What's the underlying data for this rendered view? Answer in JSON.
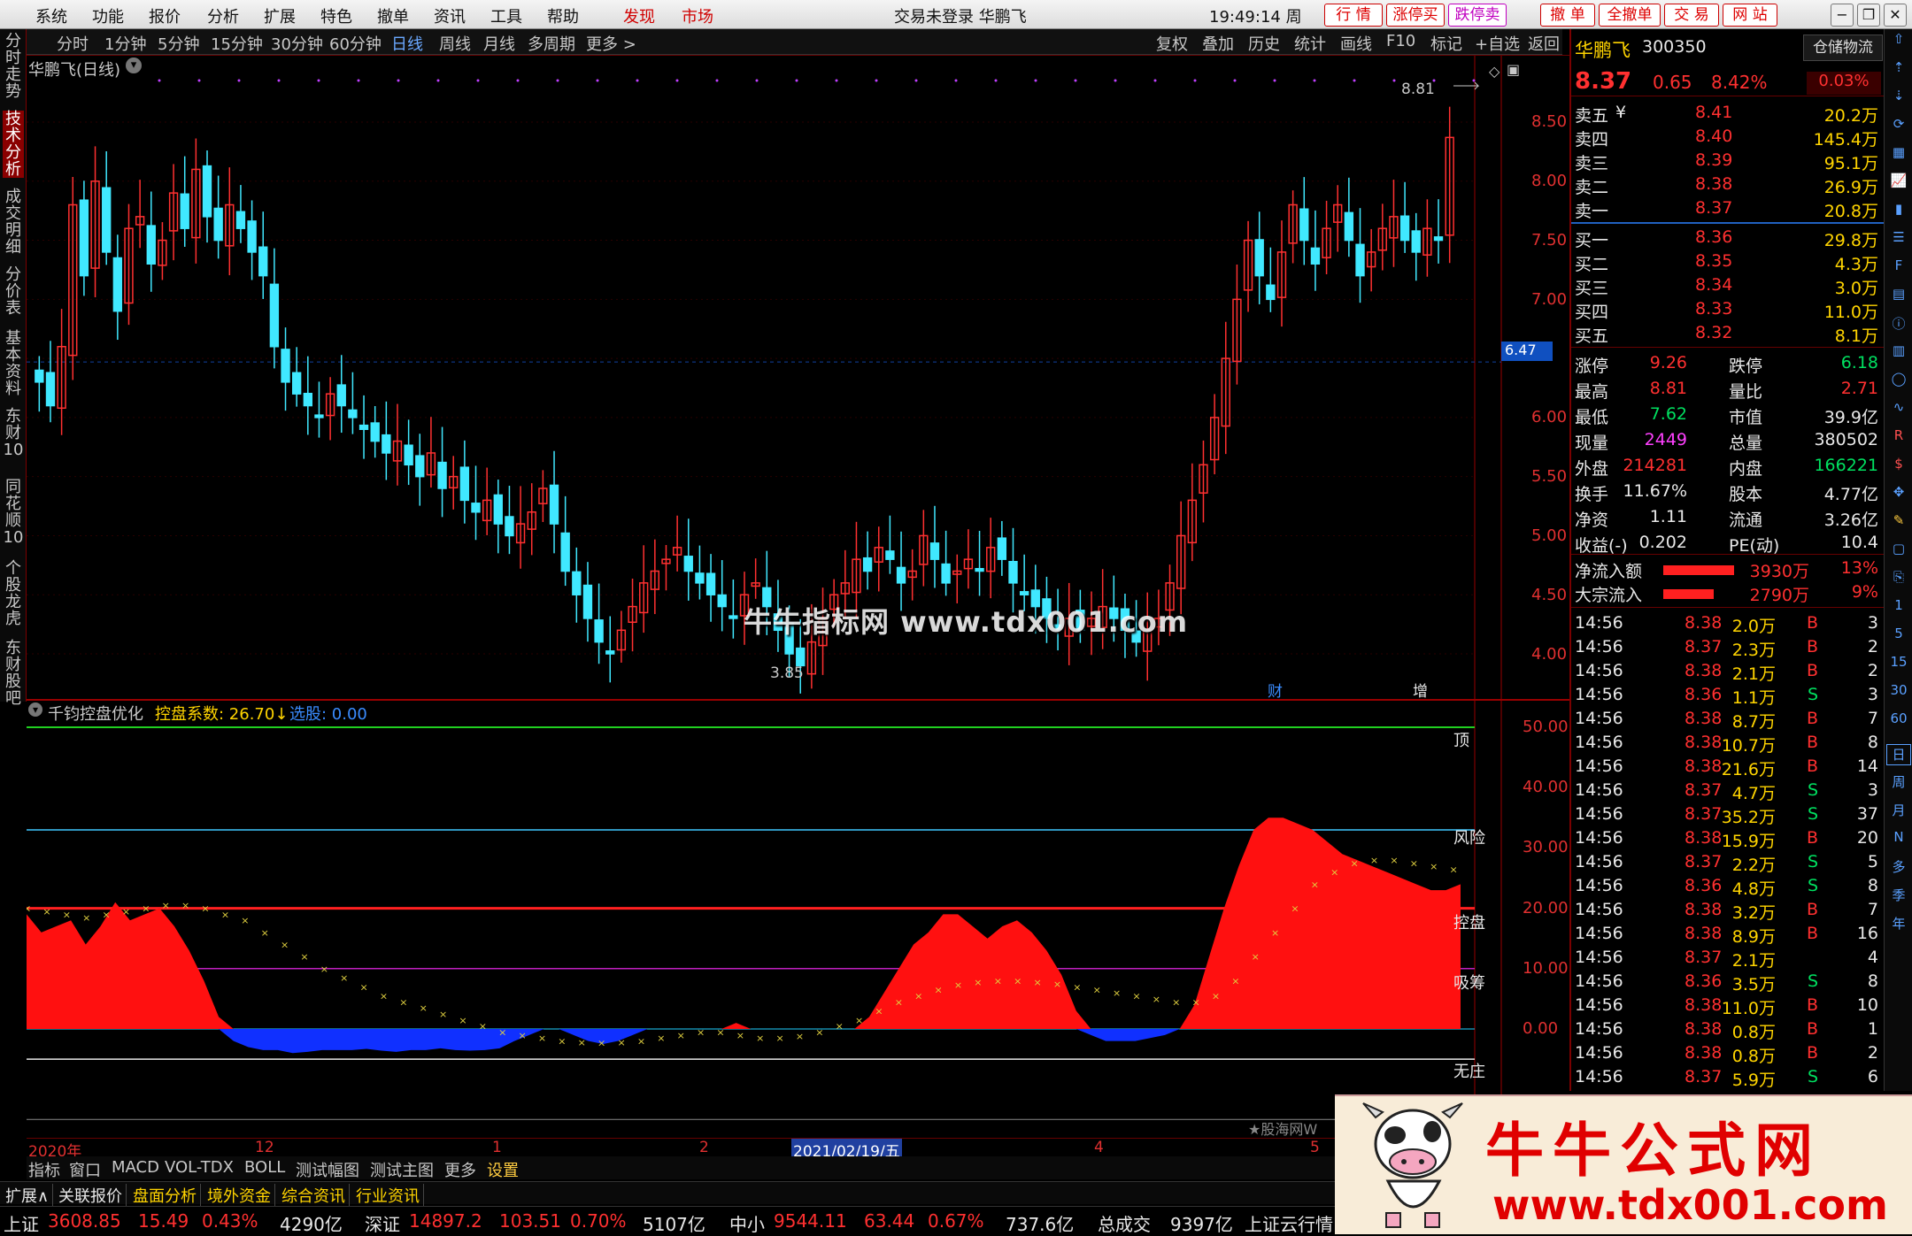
{
  "menu": {
    "items": [
      "系统",
      "功能",
      "报价",
      "分析",
      "扩展",
      "特色",
      "撤单",
      "资讯",
      "工具",
      "帮助"
    ],
    "red_items": [
      "发现",
      "市场"
    ],
    "title": "交易未登录  华鹏飞",
    "clock": "19:49:14 周四",
    "right_buttons": [
      "行 情",
      "涨停买",
      "跌停卖",
      "撤 单",
      "全撤单",
      "交 易",
      "网 站"
    ]
  },
  "periods": [
    "分时",
    "1分钟",
    "5分钟",
    "15分钟",
    "30分钟",
    "60分钟",
    "日线",
    "周线",
    "月线",
    "多周期",
    "更多 >"
  ],
  "selected_period": "日线",
  "toolbar_right": [
    "复权",
    "叠加",
    "历史",
    "统计",
    "画线",
    "F10",
    "标记",
    "+自选",
    "返回"
  ],
  "left_tabs": [
    "分时走势",
    "技术分析",
    "成交明细",
    "分价表",
    "基本资料",
    "东财10",
    "同花顺10",
    "个股龙虎",
    "东财股吧"
  ],
  "main_chart": {
    "label": "华鹏飞(日线)",
    "y_ticks": [
      "8.50",
      "8.00",
      "7.50",
      "7.00",
      "6.00",
      "5.50",
      "5.00",
      "4.50",
      "4.00"
    ],
    "current_price_tag": "6.47",
    "high_label": "8.81",
    "low_label": "3.85",
    "markers": [
      "财",
      "增"
    ]
  },
  "indicator": {
    "name": "千钧控盘优化",
    "coef_label": "控盘系数: 26.70↓",
    "select_label": "选股: 0.00",
    "y_ticks": [
      "50.00",
      "40.00",
      "30.00",
      "20.00",
      "10.00",
      "0.00"
    ],
    "levels": [
      "顶",
      "风险",
      "控盘",
      "吸筹",
      "无庄"
    ],
    "credit": "★股海网W"
  },
  "chart_data": {
    "type": "candlestick",
    "price_ylim": [
      3.85,
      8.81
    ],
    "indicator_ylim": [
      -5,
      50
    ],
    "close": [
      6.3,
      6.1,
      6.6,
      7.8,
      7.2,
      8.0,
      7.4,
      6.9,
      7.6,
      7.7,
      7.3,
      7.5,
      7.9,
      7.6,
      8.1,
      7.7,
      7.5,
      7.8,
      7.6,
      7.4,
      7.2,
      6.6,
      6.3,
      6.2,
      6.1,
      6.0,
      6.2,
      6.1,
      6.0,
      5.9,
      5.8,
      5.7,
      5.8,
      5.6,
      5.5,
      5.7,
      5.4,
      5.5,
      5.3,
      5.2,
      5.3,
      5.1,
      5.0,
      5.1,
      5.2,
      5.4,
      5.1,
      4.7,
      4.5,
      4.3,
      4.1,
      4.0,
      4.2,
      4.4,
      4.6,
      4.7,
      4.8,
      4.9,
      4.7,
      4.6,
      4.5,
      4.4,
      4.3,
      4.5,
      4.6,
      4.4,
      4.2,
      4.0,
      3.9,
      4.1,
      4.3,
      4.5,
      4.6,
      4.8,
      4.7,
      4.9,
      4.8,
      4.6,
      4.7,
      5.0,
      4.8,
      4.6,
      4.7,
      4.8,
      4.7,
      4.9,
      4.8,
      4.6,
      4.5,
      4.4,
      4.3,
      4.2,
      4.3,
      4.2,
      4.3,
      4.4,
      4.3,
      4.2,
      4.1,
      4.2,
      4.3,
      4.6,
      5.0,
      5.3,
      5.6,
      6.0,
      6.5,
      7.0,
      7.5,
      7.2,
      7.0,
      7.4,
      7.8,
      7.5,
      7.3,
      7.6,
      7.8,
      7.5,
      7.2,
      7.4,
      7.6,
      7.7,
      7.5,
      7.4,
      7.6,
      7.5,
      8.37
    ],
    "indicator_red": [
      19,
      16,
      17,
      18,
      14,
      17,
      21,
      18,
      19,
      20,
      17,
      13,
      8,
      2,
      0,
      0,
      0,
      0,
      0,
      0,
      0,
      0,
      0,
      0,
      0,
      0,
      0,
      0,
      0,
      0,
      0,
      0,
      0,
      0,
      0,
      0,
      0,
      0,
      0,
      0,
      0,
      0,
      0,
      0,
      0,
      0,
      0,
      0,
      1,
      0,
      0,
      0,
      0,
      0,
      0,
      0,
      0,
      2,
      6,
      10,
      14,
      16,
      19,
      19,
      17,
      15,
      17,
      18,
      16,
      13,
      9,
      3,
      0,
      0,
      0,
      0,
      0,
      0,
      0,
      4,
      12,
      20,
      27,
      33,
      35,
      35,
      34,
      33,
      31,
      29,
      28,
      27,
      26,
      25,
      24,
      23,
      23,
      24
    ],
    "indicator_blue": [
      0,
      0,
      0,
      0,
      0,
      0,
      0,
      0,
      0,
      0,
      0,
      0,
      0,
      0,
      -2,
      -3,
      -3.5,
      -3.5,
      -4,
      -3.8,
      -3.5,
      -3.5,
      -3.5,
      -3.3,
      -3.6,
      -3.8,
      -3.5,
      -3.5,
      -3.2,
      -3.5,
      -3.6,
      -3.5,
      -3.2,
      -2,
      -1,
      0,
      0,
      -1,
      -2,
      -2.5,
      -2,
      -1,
      0,
      0,
      0,
      0,
      0,
      0,
      0,
      0,
      0,
      0,
      0,
      0,
      0,
      0,
      0,
      0,
      0,
      0,
      0,
      0,
      0,
      0,
      0,
      0,
      0,
      0,
      0,
      0,
      0,
      0,
      -1,
      -2,
      -2,
      -2,
      -1.5,
      -1,
      0,
      0,
      0,
      0,
      0,
      0,
      0,
      0,
      0,
      0,
      0,
      0,
      0,
      0,
      0,
      0,
      0,
      0,
      0,
      0
    ],
    "indicator_signal": [
      20,
      19.5,
      19,
      18.5,
      19,
      19.5,
      20,
      20.5,
      20.5,
      20,
      19,
      18,
      16,
      14,
      12,
      10,
      8.5,
      7,
      5.5,
      4.5,
      3.5,
      2.5,
      1.5,
      0.5,
      -0.5,
      -1,
      -1.5,
      -2,
      -2.2,
      -2.3,
      -2.2,
      -2,
      -1.5,
      -1,
      -0.5,
      -0.5,
      -1,
      -1.5,
      -1.5,
      -1.2,
      -0.5,
      0.5,
      1.5,
      3,
      4.5,
      5.5,
      6.5,
      7.3,
      7.8,
      8,
      8,
      7.8,
      7.5,
      7,
      6.5,
      6,
      5.5,
      5,
      4.5,
      4.5,
      5.5,
      8,
      12,
      16,
      20,
      24,
      26,
      27.5,
      28,
      28,
      27.5,
      27,
      26.5
    ]
  },
  "quote": {
    "name": "华鹏飞",
    "code": "300350",
    "tab": "仓储物流",
    "price": "8.37",
    "change": "0.65",
    "pct": "8.42%",
    "committee": "0.03%",
    "asks": [
      {
        "label": "卖五",
        "price": "8.41",
        "vol": "20.2万"
      },
      {
        "label": "卖四",
        "price": "8.40",
        "vol": "145.4万"
      },
      {
        "label": "卖三",
        "price": "8.39",
        "vol": "95.1万"
      },
      {
        "label": "卖二",
        "price": "8.38",
        "vol": "26.9万"
      },
      {
        "label": "卖一",
        "price": "8.37",
        "vol": "20.8万"
      }
    ],
    "bids": [
      {
        "label": "买一",
        "price": "8.36",
        "vol": "29.8万"
      },
      {
        "label": "买二",
        "price": "8.35",
        "vol": "4.3万"
      },
      {
        "label": "买三",
        "price": "8.34",
        "vol": "3.0万"
      },
      {
        "label": "买四",
        "price": "8.33",
        "vol": "11.0万"
      },
      {
        "label": "买五",
        "price": "8.32",
        "vol": "8.1万"
      }
    ],
    "ask_yuan": "¥",
    "stats": [
      [
        "涨停",
        "9.26",
        "跌停",
        "6.18"
      ],
      [
        "最高",
        "8.81",
        "量比",
        "2.71"
      ],
      [
        "最低",
        "7.62",
        "市值",
        "39.9亿"
      ],
      [
        "现量",
        "2449",
        "总量",
        "380502"
      ],
      [
        "外盘",
        "214281",
        "内盘",
        "166221"
      ],
      [
        "换手",
        "11.67%",
        "股本",
        "4.77亿"
      ],
      [
        "净资",
        "1.11",
        "流通",
        "3.26亿"
      ],
      [
        "收益(-)",
        "0.202",
        "PE(动)",
        "10.4"
      ]
    ],
    "flows": [
      {
        "label": "净流入额",
        "val": "3930万",
        "pct": "13%"
      },
      {
        "label": "大宗流入",
        "val": "2790万",
        "pct": "9%"
      }
    ],
    "ticks": [
      [
        "14:56",
        "8.38",
        "2.0万",
        "B",
        "3"
      ],
      [
        "14:56",
        "8.37",
        "2.3万",
        "B",
        "2"
      ],
      [
        "14:56",
        "8.38",
        "2.1万",
        "B",
        "2"
      ],
      [
        "14:56",
        "8.36",
        "1.1万",
        "S",
        "3"
      ],
      [
        "14:56",
        "8.38",
        "8.7万",
        "B",
        "7"
      ],
      [
        "14:56",
        "8.38",
        "10.7万",
        "B",
        "8"
      ],
      [
        "14:56",
        "8.38",
        "21.6万",
        "B",
        "14"
      ],
      [
        "14:56",
        "8.37",
        "4.7万",
        "S",
        "3"
      ],
      [
        "14:56",
        "8.37",
        "35.2万",
        "S",
        "37"
      ],
      [
        "14:56",
        "8.38",
        "15.9万",
        "B",
        "20"
      ],
      [
        "14:56",
        "8.37",
        "2.2万",
        "S",
        "5"
      ],
      [
        "14:56",
        "8.36",
        "4.8万",
        "S",
        "8"
      ],
      [
        "14:56",
        "8.38",
        "3.2万",
        "B",
        "7"
      ],
      [
        "14:56",
        "8.38",
        "8.9万",
        "B",
        "16"
      ],
      [
        "14:56",
        "8.37",
        "2.1万",
        "",
        "4"
      ],
      [
        "14:56",
        "8.36",
        "3.5万",
        "S",
        "8"
      ],
      [
        "14:56",
        "8.38",
        "11.0万",
        "B",
        "10"
      ],
      [
        "14:56",
        "8.38",
        "0.8万",
        "B",
        "1"
      ],
      [
        "14:56",
        "8.38",
        "0.8万",
        "B",
        "2"
      ],
      [
        "14:56",
        "8.37",
        "5.9万",
        "S",
        "6"
      ]
    ]
  },
  "right_nav": [
    "日",
    "周",
    "月",
    "N",
    "多",
    "季",
    "年",
    "1",
    "5",
    "15",
    "30",
    "60"
  ],
  "x_axis": [
    "2020年",
    "12",
    "1",
    "2",
    "2021/02/19/五",
    "4",
    "5"
  ],
  "indicator_tabs": [
    "指标",
    "窗口",
    "MACD",
    "VOL-TDX",
    "BOLL",
    "测试幅图",
    "测试主图",
    "更多",
    "设置"
  ],
  "bottom_tabs": [
    "扩展∧",
    "关联报价",
    "盘面分析",
    "境外资金",
    "综合资讯",
    "行业资讯"
  ],
  "status": {
    "sh_label": "上证",
    "sh": "3608.85",
    "sh_chg": "15.49",
    "sh_pct": "0.43%",
    "sh_amt": "4290亿",
    "sz_label": "深证",
    "sz": "14897.2",
    "sz_chg": "103.51",
    "sz_pct": "0.70%",
    "sz_amt": "5107亿",
    "zx_label": "中小",
    "zx": "9544.11",
    "zx_chg": "63.44",
    "zx_pct": "0.67%",
    "zx_amt": "737.6亿",
    "total_label": "总成交",
    "total": "9397亿",
    "cloud": "上证云行情"
  },
  "watermark": "牛牛指标网 www.tdx001.com",
  "ad": {
    "title": "牛牛公式网",
    "url": "www.tdx001.com"
  }
}
